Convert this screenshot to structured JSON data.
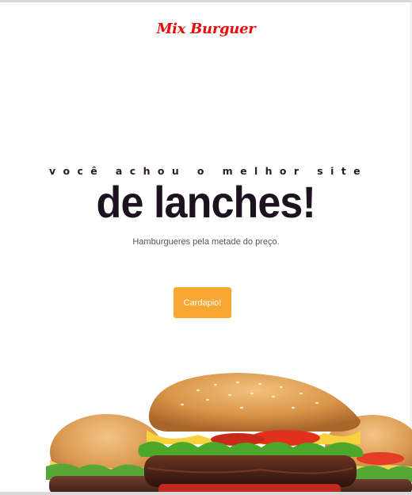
{
  "header": {
    "brand": "Mix Burguer"
  },
  "hero": {
    "tagline": "você achou o melhor site",
    "headline": "de lanches!",
    "subtitle": "Hamburgueres pela metade do preço.",
    "cta_label": "Cardapio!"
  },
  "colors": {
    "brand": "#ea0a0a",
    "headline": "#1d1320",
    "cta": "#f8a732"
  }
}
